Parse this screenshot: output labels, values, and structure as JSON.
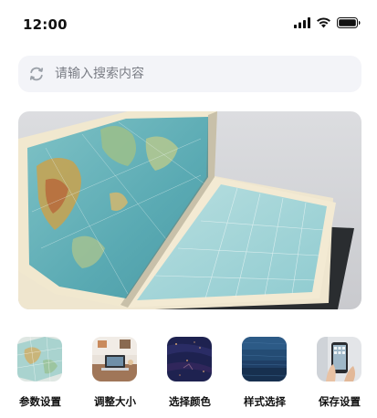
{
  "status_bar": {
    "time": "12:00",
    "icons": [
      "signal-icon",
      "wifi-icon",
      "battery-icon"
    ]
  },
  "search": {
    "placeholder": "请输入搜索内容",
    "value": "",
    "icon": "search-icon"
  },
  "hero": {
    "image": "open-atlas-map-photo"
  },
  "menu": {
    "items": [
      {
        "label": "参数设置",
        "thumb": "map-thumbnail"
      },
      {
        "label": "调整大小",
        "thumb": "desk-laptop-thumbnail"
      },
      {
        "label": "选择颜色",
        "thumb": "dark-texture-thumbnail"
      },
      {
        "label": "样式选择",
        "thumb": "blue-fabric-thumbnail"
      },
      {
        "label": "保存设置",
        "thumb": "phone-in-hand-thumbnail"
      }
    ]
  },
  "colors": {
    "search_bg": "#f3f4f8",
    "text": "#111111",
    "placeholder": "#7a7d85"
  }
}
